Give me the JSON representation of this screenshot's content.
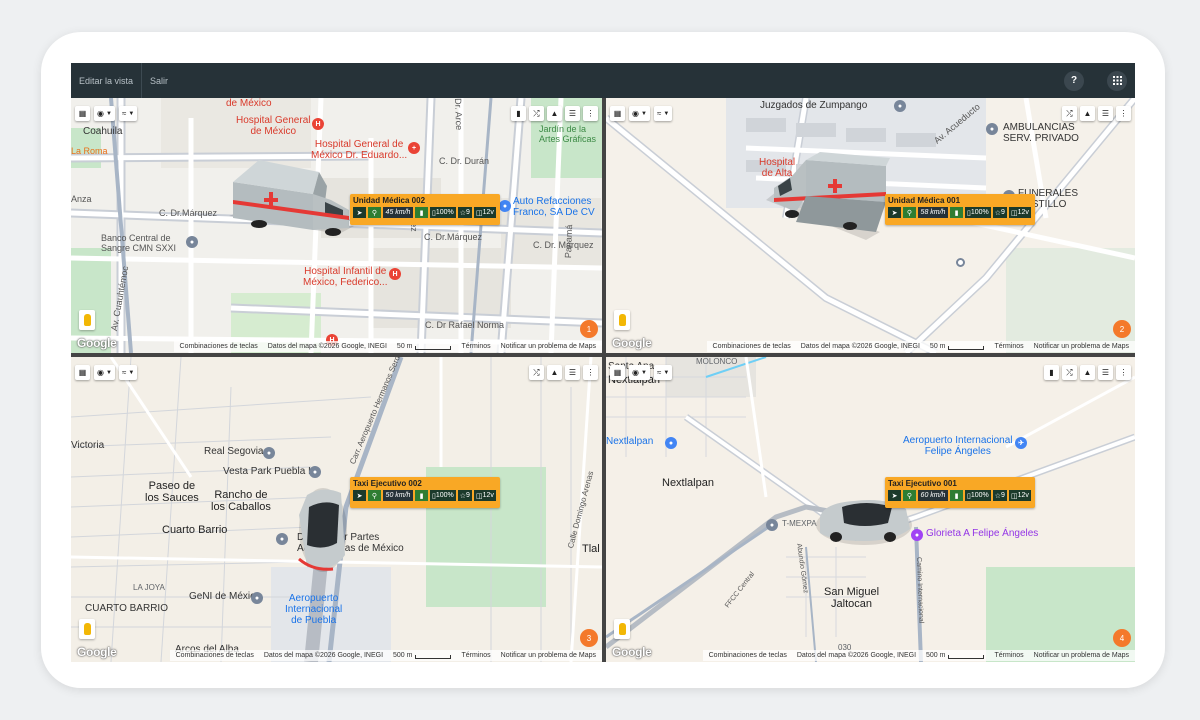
{
  "topbar": {
    "edit_view": "Editar la vista",
    "exit": "Salir",
    "help_icon": "?",
    "apps_icon": "⋮⋮"
  },
  "colors": {
    "topbar": "#263238",
    "infobox": "#f9a825",
    "badge": "#f4792b",
    "divider": "#444444"
  },
  "common": {
    "google": "Google",
    "keyboard": "Combinaciones de teclas",
    "map_data": "Datos del mapa ©2026 Google, INEGI",
    "terms": "Términos",
    "report": "Notificar un problema de Maps"
  },
  "panels": [
    {
      "number": "1",
      "scale": "50 m",
      "vehicle_icon": "ambulance-icon",
      "info": {
        "title": "Unidad Médica 002",
        "speed": "45 km/h",
        "battery": "100%",
        "sats": "9",
        "voltage": "12v"
      },
      "labels": {
        "mexico_top": "de México",
        "coahuila": "Coahuila",
        "hospital_general": "Hospital General\nde México",
        "hospital_general2": "Hospital General de\nMéxico Dr. Eduardo...",
        "la_roma": "La Roma",
        "duran": "C. Dr. Durán",
        "jardin": "Jardín de la\nArtes Gráficas",
        "anza": "Anza",
        "marquez": "C. Dr.Márquez",
        "marquez2": "C. Dr.Márquez",
        "marquez3": "C. Dr. Márquez",
        "refacciones": "Auto Refacciones\nFranco, SA De CV",
        "banco": "Banco Central de\nSangre CMN SXXI",
        "infantil": "Hospital Infantil de\nMéxico, Federico...",
        "panama": "Panamá",
        "rafael": "C. Dr Rafael Norma",
        "cuauhtemoc": "Av. Cuauhtémoc",
        "jimenez": "Jiménez",
        "arce": "Dr. Arce"
      }
    },
    {
      "number": "2",
      "scale": "50 m",
      "vehicle_icon": "ambulance-icon",
      "info": {
        "title": "Unidad Médica 001",
        "speed": "58 km/h",
        "battery": "100%",
        "sats": "9",
        "voltage": "12v"
      },
      "labels": {
        "juzgados": "Juzgados de Zumpango",
        "ambulancias": "AMBULANCIAS\nSERV. PRIVADO",
        "funerales": "FUNERALES\nCASTILLO",
        "hospital_alta": "Hospital\nde Alta",
        "acueducto": "Av. Acueducto"
      }
    },
    {
      "number": "3",
      "scale": "500 m",
      "vehicle_icon": "taxi-car-icon",
      "info": {
        "title": "Taxi Ejecutivo 002",
        "speed": "50 km/h",
        "battery": "100%",
        "sats": "9",
        "voltage": "12v"
      },
      "labels": {
        "victoria": "Victoria",
        "real_segovia": "Real Segovia",
        "vesta_park": "Vesta Park Puebla I",
        "paseo": "Paseo de\nlos Sauces",
        "rancho": "Rancho de\nlos Caballos",
        "cuarto_barrio": "Cuarto Barrio",
        "distribuidor": "Distribuidor Partes\nAeronáuticas de México",
        "la_joya": "LA JOYA",
        "cuarto_barrio_caps": "CUARTO BARRIO",
        "geni": "GeNI de México",
        "aeropuerto": "Aeropuerto\nInternacional\nde Puebla",
        "arcos": "Arcos del Alba",
        "carr": "Carr. Aeropuerto Hermanos Serdán",
        "domingo": "Calle Domingo Arenas",
        "tlal": "Tlal"
      }
    },
    {
      "number": "4",
      "scale": "500 m",
      "vehicle_icon": "taxi-car-icon",
      "info": {
        "title": "Taxi Ejecutivo 001",
        "speed": "60 km/h",
        "battery": "100%",
        "sats": "9",
        "voltage": "12v"
      },
      "labels": {
        "molonco": "MOLONCO",
        "santa_ana": "Santa Ana",
        "nextlalpan_top": "Nextlalpan",
        "nextlalpan_place": "Nextlalpan",
        "nextlalpan_center": "Nextlalpan",
        "aeropuerto": "Aeropuerto Internacional\nFelipe Ángeles",
        "tmexpa": "T-MEXPA",
        "glorieta": "Glorieta A Felipe Ángeles",
        "san_miguel": "San Miguel\nJaltocan",
        "ffcc": "FFCC Central",
        "camino": "Camino Internacional",
        "abundio": "Abundio Gómez",
        "num": "030"
      }
    }
  ]
}
